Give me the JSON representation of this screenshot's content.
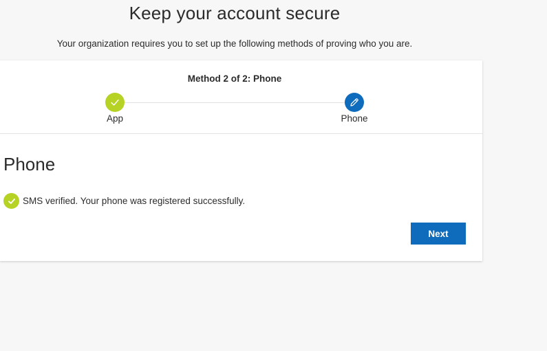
{
  "header": {
    "title": "Keep your account secure",
    "subtitle": "Your organization requires you to set up the following methods of proving who you are."
  },
  "card": {
    "method_label": "Method 2 of 2: Phone",
    "steps": [
      {
        "label": "App",
        "status": "complete",
        "icon": "checkmark-icon",
        "color": "#b6d224"
      },
      {
        "label": "Phone",
        "status": "current",
        "icon": "pencil-icon",
        "color": "#0f6cbd"
      }
    ],
    "section_title": "Phone",
    "success_message": "SMS verified. Your phone was registered successfully.",
    "next_label": "Next"
  },
  "colors": {
    "accent": "#0f6cbd",
    "success": "#b6d224",
    "background": "#f7f7f7"
  }
}
